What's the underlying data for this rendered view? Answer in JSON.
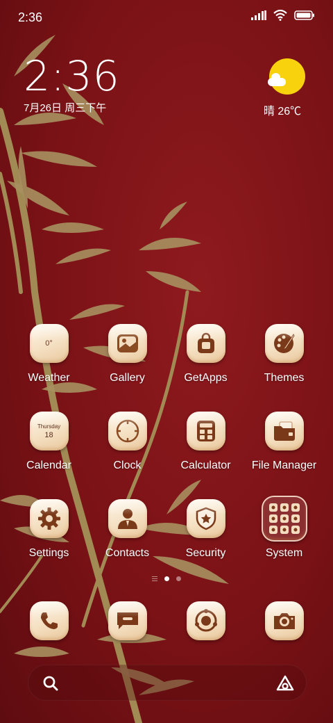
{
  "status_bar": {
    "time": "2:36"
  },
  "clock_widget": {
    "time": "2:36",
    "date": "7月26日 周三下午"
  },
  "weather_widget": {
    "text": "晴 26℃",
    "icon": "sunny-cloud-icon"
  },
  "apps": [
    {
      "name": "weather",
      "label": "Weather",
      "icon": "weather-icon",
      "tile_text": "0°"
    },
    {
      "name": "gallery",
      "label": "Gallery",
      "icon": "gallery-icon"
    },
    {
      "name": "getapps",
      "label": "GetApps",
      "icon": "shopping-bag-icon"
    },
    {
      "name": "themes",
      "label": "Themes",
      "icon": "palette-icon"
    },
    {
      "name": "calendar",
      "label": "Calendar",
      "icon": "calendar-icon",
      "tile_day": "Thursday",
      "tile_date": "18"
    },
    {
      "name": "clock",
      "label": "Clock",
      "icon": "clock-icon"
    },
    {
      "name": "calculator",
      "label": "Calculator",
      "icon": "calculator-icon"
    },
    {
      "name": "file-manager",
      "label": "File Manager",
      "icon": "folder-icon"
    },
    {
      "name": "settings",
      "label": "Settings",
      "icon": "gear-icon"
    },
    {
      "name": "contacts",
      "label": "Contacts",
      "icon": "person-icon"
    },
    {
      "name": "security",
      "label": "Security",
      "icon": "shield-icon"
    },
    {
      "name": "system",
      "label": "System",
      "icon": "folder-grid-icon"
    }
  ],
  "page_indicator": {
    "pages": 2,
    "current": 1
  },
  "dock": [
    {
      "name": "phone",
      "icon": "phone-icon"
    },
    {
      "name": "messages",
      "icon": "message-icon"
    },
    {
      "name": "browser",
      "icon": "browser-icon"
    },
    {
      "name": "camera",
      "icon": "camera-icon"
    }
  ],
  "search_bar": {
    "left_icon": "search-icon",
    "right_icon": "assistant-icon"
  },
  "colors": {
    "background": "#7a1216",
    "icon_tile": "#f4dfc1",
    "icon_glyph": "#7a3a1a",
    "sun": "#f8d20c"
  }
}
